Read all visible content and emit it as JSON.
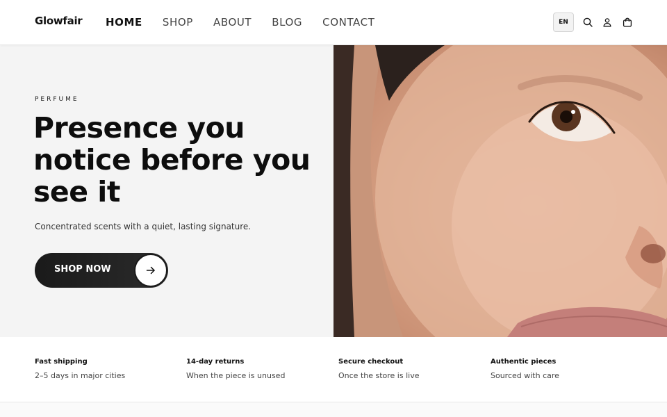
{
  "header": {
    "logo": "Glowfair",
    "nav": [
      {
        "label": "HOME",
        "active": true
      },
      {
        "label": "SHOP",
        "active": false
      },
      {
        "label": "ABOUT",
        "active": false
      },
      {
        "label": "BLOG",
        "active": false
      },
      {
        "label": "CONTACT",
        "active": false
      }
    ],
    "language": "EN",
    "icons": [
      "search-icon",
      "user-icon",
      "cart-icon"
    ]
  },
  "hero": {
    "eyebrow": "PERFUME",
    "headline_lines": [
      "Presence you",
      "notice before you",
      "see it"
    ],
    "subtext": "Concentrated scents with a quiet, lasting signature.",
    "cta_label": "SHOP NOW",
    "cta_icon": "arrow-right-icon"
  },
  "features": [
    {
      "title": "Fast shipping",
      "desc": "2–5 days in major cities"
    },
    {
      "title": "14-day returns",
      "desc": "When the piece is unused"
    },
    {
      "title": "Secure checkout",
      "desc": "Once the store is live"
    },
    {
      "title": "Authentic pieces",
      "desc": "Sourced with care"
    }
  ],
  "colors": {
    "text": "#111111",
    "hero_bg": "#f4f4f4",
    "button": "#1a1a1a",
    "button_text": "#ffffff"
  }
}
